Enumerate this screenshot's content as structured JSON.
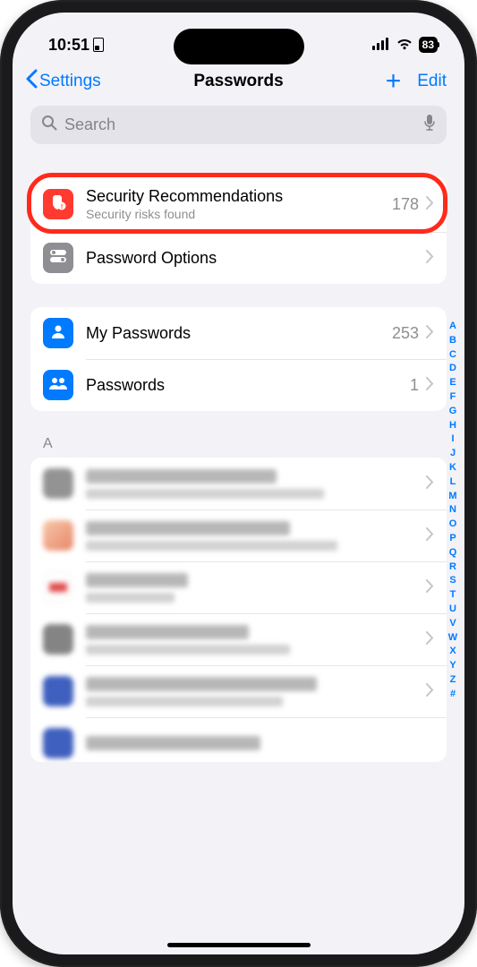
{
  "status": {
    "time": "10:51",
    "battery": "83"
  },
  "nav": {
    "back": "Settings",
    "title": "Passwords",
    "edit": "Edit"
  },
  "search": {
    "placeholder": "Search"
  },
  "rows": {
    "security": {
      "title": "Security Recommendations",
      "sub": "Security risks found",
      "count": "178"
    },
    "options": {
      "title": "Password Options"
    },
    "my": {
      "title": "My Passwords",
      "count": "253"
    },
    "shared": {
      "title": "Passwords",
      "count": "1"
    }
  },
  "section_letter": "A",
  "alpha_index": [
    "A",
    "B",
    "C",
    "D",
    "E",
    "F",
    "G",
    "H",
    "I",
    "J",
    "K",
    "L",
    "M",
    "N",
    "O",
    "P",
    "Q",
    "R",
    "S",
    "T",
    "U",
    "V",
    "W",
    "X",
    "Y",
    "Z",
    "#"
  ],
  "colors": {
    "accent": "#007aff",
    "security_icon_bg": "#ff3a30",
    "options_icon_bg": "#8e8e93",
    "person_icon_bg": "#007aff",
    "highlight": "#ff2a1c"
  }
}
